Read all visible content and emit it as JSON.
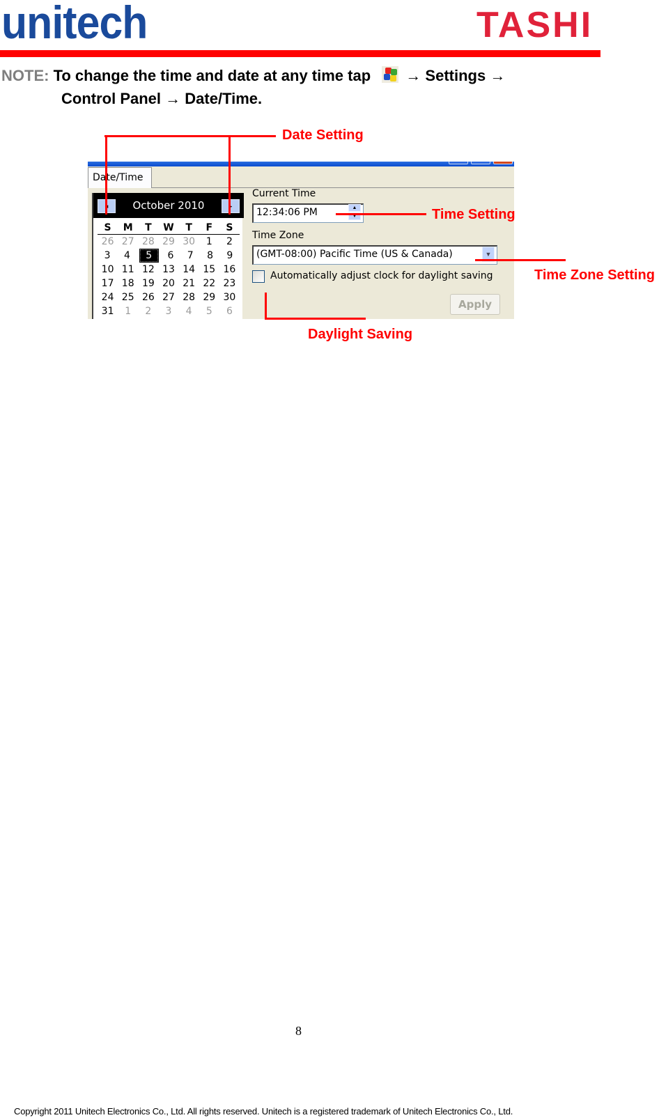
{
  "header": {
    "brand_left": "unitech",
    "brand_right": "TASHI",
    "brand_left_color": "#1a4a9b",
    "brand_right_color": "#e0223a",
    "rule_color": "#ff0000"
  },
  "note": {
    "label": "NOTE:",
    "text_before_icon": "To change the time and date at any time tap",
    "icon": "windows-start-icon",
    "arrow": "→",
    "step1": "Settings",
    "step2": "Control Panel",
    "step3": "Date/Time."
  },
  "annotations": {
    "date_setting": "Date Setting",
    "time_setting": "Time Setting",
    "time_zone_setting": "Time Zone Setting",
    "daylight_saving": "Daylight Saving",
    "color": "#ff0000"
  },
  "dialog": {
    "tab_label": "Date/Time",
    "calendar": {
      "month_year": "October 2010",
      "prev_icon": "◂",
      "next_icon": "▸",
      "weekdays": [
        "S",
        "M",
        "T",
        "W",
        "T",
        "F",
        "S"
      ],
      "weeks": [
        [
          {
            "d": "26",
            "o": true
          },
          {
            "d": "27",
            "o": true
          },
          {
            "d": "28",
            "o": true
          },
          {
            "d": "29",
            "o": true
          },
          {
            "d": "30",
            "o": true
          },
          {
            "d": "1"
          },
          {
            "d": "2"
          }
        ],
        [
          {
            "d": "3"
          },
          {
            "d": "4"
          },
          {
            "d": "5",
            "sel": true
          },
          {
            "d": "6"
          },
          {
            "d": "7"
          },
          {
            "d": "8"
          },
          {
            "d": "9"
          }
        ],
        [
          {
            "d": "10"
          },
          {
            "d": "11"
          },
          {
            "d": "12"
          },
          {
            "d": "13"
          },
          {
            "d": "14"
          },
          {
            "d": "15"
          },
          {
            "d": "16"
          }
        ],
        [
          {
            "d": "17"
          },
          {
            "d": "18"
          },
          {
            "d": "19"
          },
          {
            "d": "20"
          },
          {
            "d": "21"
          },
          {
            "d": "22"
          },
          {
            "d": "23"
          }
        ],
        [
          {
            "d": "24"
          },
          {
            "d": "25"
          },
          {
            "d": "26"
          },
          {
            "d": "27"
          },
          {
            "d": "28"
          },
          {
            "d": "29"
          },
          {
            "d": "30"
          }
        ],
        [
          {
            "d": "31"
          },
          {
            "d": "1",
            "o": true
          },
          {
            "d": "2",
            "o": true
          },
          {
            "d": "3",
            "o": true
          },
          {
            "d": "4",
            "o": true
          },
          {
            "d": "5",
            "o": true
          },
          {
            "d": "6",
            "o": true
          }
        ]
      ],
      "selected_day": "5"
    },
    "current_time_label": "Current Time",
    "current_time_value": "12:34:06 PM",
    "time_zone_label": "Time Zone",
    "time_zone_value": "(GMT-08:00) Pacific Time (US & Canada)",
    "daylight_checkbox_label": "Automatically adjust clock for daylight saving",
    "daylight_checked": false,
    "apply_label": "Apply"
  },
  "page_number": "8",
  "footer": "Copyright 2011 Unitech Electronics Co., Ltd. All rights reserved. Unitech is a registered trademark of Unitech Electronics Co., Ltd."
}
